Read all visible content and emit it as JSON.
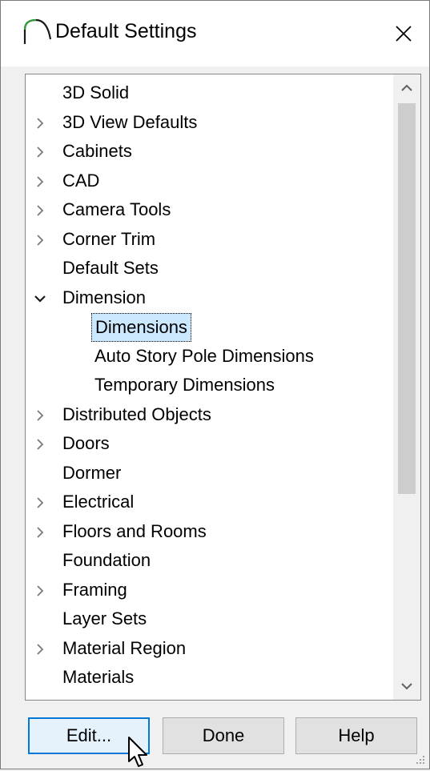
{
  "window": {
    "title": "Default Settings"
  },
  "tree": {
    "items": [
      {
        "label": "3D Solid",
        "level": 0,
        "expander": "none"
      },
      {
        "label": "3D View Defaults",
        "level": 0,
        "expander": "collapsed"
      },
      {
        "label": "Cabinets",
        "level": 0,
        "expander": "collapsed"
      },
      {
        "label": "CAD",
        "level": 0,
        "expander": "collapsed"
      },
      {
        "label": "Camera Tools",
        "level": 0,
        "expander": "collapsed"
      },
      {
        "label": "Corner Trim",
        "level": 0,
        "expander": "collapsed"
      },
      {
        "label": "Default Sets",
        "level": 0,
        "expander": "none"
      },
      {
        "label": "Dimension",
        "level": 0,
        "expander": "expanded"
      },
      {
        "label": "Dimensions",
        "level": 1,
        "expander": "none",
        "selected": true
      },
      {
        "label": "Auto Story Pole Dimensions",
        "level": 1,
        "expander": "none"
      },
      {
        "label": "Temporary Dimensions",
        "level": 1,
        "expander": "none"
      },
      {
        "label": "Distributed Objects",
        "level": 0,
        "expander": "collapsed"
      },
      {
        "label": "Doors",
        "level": 0,
        "expander": "collapsed"
      },
      {
        "label": "Dormer",
        "level": 0,
        "expander": "none"
      },
      {
        "label": "Electrical",
        "level": 0,
        "expander": "collapsed"
      },
      {
        "label": "Floors and Rooms",
        "level": 0,
        "expander": "collapsed"
      },
      {
        "label": "Foundation",
        "level": 0,
        "expander": "none"
      },
      {
        "label": "Framing",
        "level": 0,
        "expander": "collapsed"
      },
      {
        "label": "Layer Sets",
        "level": 0,
        "expander": "none"
      },
      {
        "label": "Material Region",
        "level": 0,
        "expander": "collapsed"
      },
      {
        "label": "Materials",
        "level": 0,
        "expander": "none"
      }
    ]
  },
  "buttons": {
    "edit": "Edit...",
    "done": "Done",
    "help": "Help"
  },
  "colors": {
    "selection": "#cce8ff",
    "default_button_border": "#0078d7",
    "scroll_thumb": "#cdcdcd"
  },
  "icons": {
    "app": "arch-icon",
    "close": "close-icon",
    "expander_collapsed": "chevron-right-icon",
    "expander_expanded": "chevron-down-icon",
    "scroll_up": "chevron-up-icon",
    "scroll_down": "chevron-down-icon",
    "cursor": "mouse-pointer-icon"
  }
}
